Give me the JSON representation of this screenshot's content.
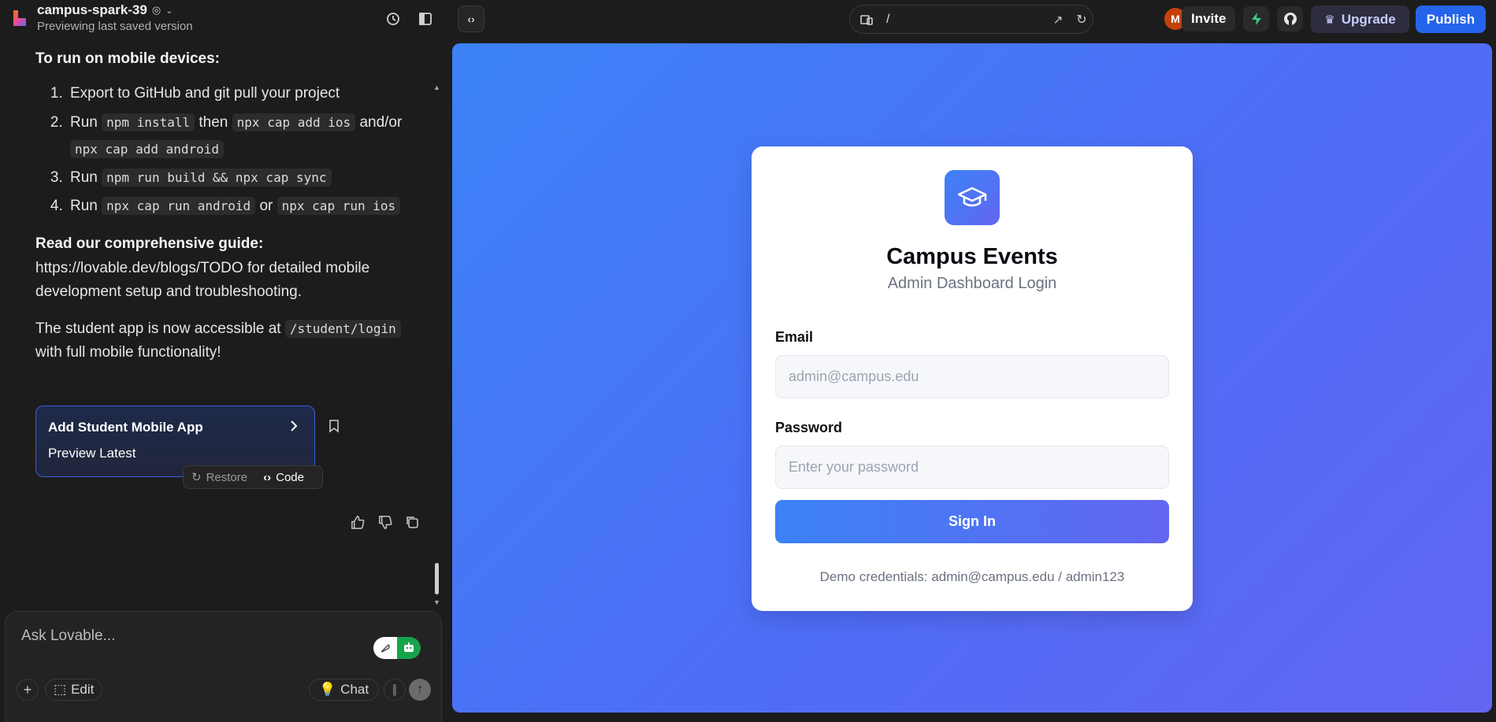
{
  "topbar": {
    "project_name": "campus-spark-39",
    "project_status": "Previewing last saved version",
    "url_path": "/",
    "avatar_initial": "M",
    "invite_label": "Invite",
    "upgrade_label": "Upgrade",
    "publish_label": "Publish"
  },
  "chat": {
    "mobile_heading": "To run on mobile devices:",
    "steps": {
      "s1": "Export to GitHub and git pull your project",
      "s2_run": "Run",
      "s2_code1": "npm install",
      "s2_then": "then",
      "s2_code2": "npx cap add ios",
      "s2_andor": "and/or",
      "s2_code3": "npx cap add android",
      "s3_run": "Run",
      "s3_code": "npm run build && npx cap sync",
      "s4_run": "Run",
      "s4_code1": "npx cap run android",
      "s4_or": "or",
      "s4_code2": "npx cap run ios"
    },
    "guide_heading": "Read our comprehensive guide:",
    "guide_text": "https://lovable.dev/blogs/TODO for detailed mobile development setup and troubleshooting.",
    "student_pre": "The student app is now accessible at",
    "student_code": "/student/login",
    "student_post": "with full mobile functionality!",
    "card_title": "Add Student Mobile App",
    "card_sub": "Preview Latest",
    "restore_label": "Restore",
    "code_label": "Code"
  },
  "composer": {
    "placeholder": "Ask Lovable...",
    "edit_label": "Edit",
    "chat_label": "Chat"
  },
  "login": {
    "title": "Campus Events",
    "subtitle": "Admin Dashboard Login",
    "email_label": "Email",
    "email_placeholder": "admin@campus.edu",
    "password_label": "Password",
    "password_placeholder": "Enter your password",
    "signin_label": "Sign In",
    "demo_text": "Demo credentials: admin@campus.edu / admin123"
  },
  "colors": {
    "accent": "#2563eb",
    "gradient_start": "#3b82f6",
    "gradient_end": "#6366f1",
    "success": "#16a34a"
  }
}
